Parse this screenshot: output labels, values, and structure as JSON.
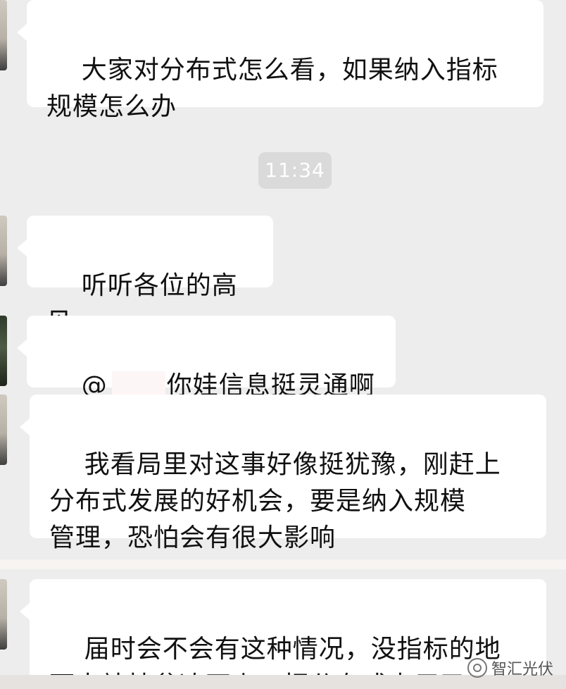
{
  "messages": [
    {
      "id": "m1",
      "text": "大家对分布式怎么看，如果纳入指标\n规模怎么办"
    },
    {
      "id": "m2",
      "text": "听听各位的高见"
    },
    {
      "id": "m3",
      "prefix": "@",
      "suffix": "你娃信息挺灵通啊"
    },
    {
      "id": "m4",
      "text": "我看局里对这事好像挺犹豫，刚赶上\n分布式发展的好机会，要是纳入规模\n管理，恐怕会有很大影响"
    },
    {
      "id": "m5",
      "text": "届时会不会有这种情况，没指标的地\n面电站扶贫凑不上，把分布式占用了"
    }
  ],
  "time_separator": "11:34",
  "watermark": {
    "text": "智汇光伏",
    "icon": "wechat-official-account-icon"
  }
}
